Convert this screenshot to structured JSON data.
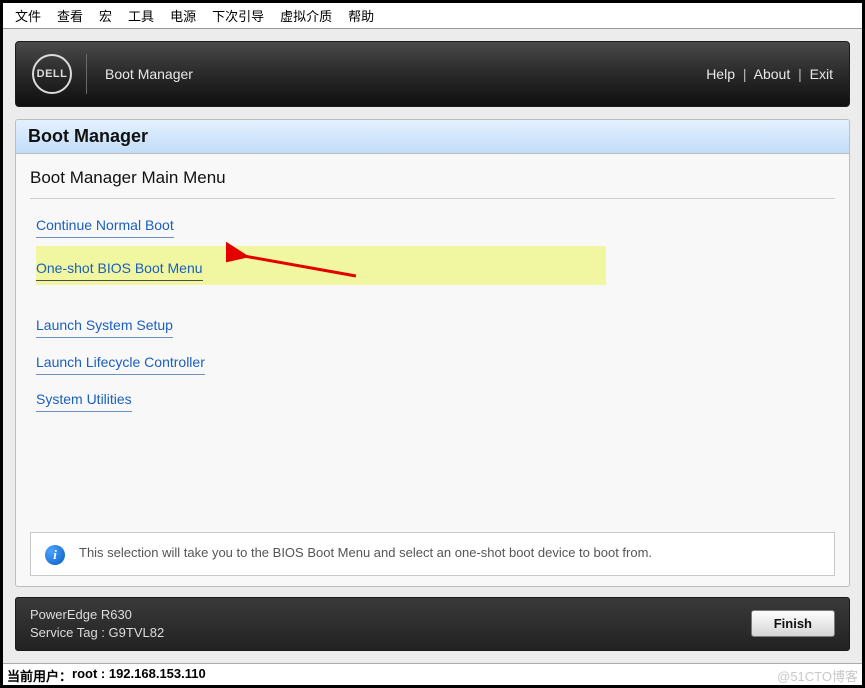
{
  "menubar": {
    "items": [
      "文件",
      "查看",
      "宏",
      "工具",
      "电源",
      "下次引导",
      "虚拟介质",
      "帮助"
    ]
  },
  "header": {
    "logo_text": "DELL",
    "title": "Boot Manager",
    "links": {
      "help": "Help",
      "about": "About",
      "exit": "Exit"
    },
    "sep": "|"
  },
  "panel": {
    "title": "Boot Manager",
    "subtitle": "Boot Manager Main Menu"
  },
  "menu": {
    "group1": [
      {
        "label": "Continue Normal Boot",
        "highlight": false
      },
      {
        "label": "One-shot BIOS Boot Menu",
        "highlight": true
      }
    ],
    "group2": [
      {
        "label": "Launch System Setup"
      },
      {
        "label": "Launch Lifecycle Controller"
      },
      {
        "label": "System Utilities"
      }
    ]
  },
  "info": {
    "text": "This selection will take you to the BIOS Boot Menu and select an one-shot boot device to boot from."
  },
  "footer": {
    "model": "PowerEdge R630",
    "service_tag_label": "Service Tag :",
    "service_tag": "G9TVL82",
    "finish_label": "Finish"
  },
  "status": {
    "user_label": "当前用户：",
    "user": "root : 192.168.153.110",
    "watermark": "@51CTO博客"
  }
}
